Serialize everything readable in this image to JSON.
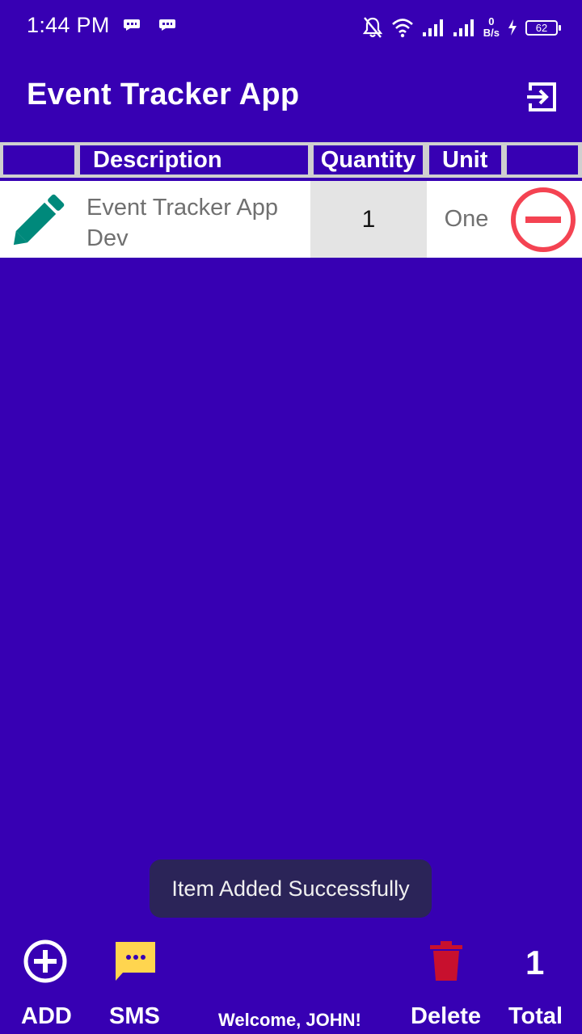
{
  "status_bar": {
    "time": "1:44 PM",
    "net_speed_value": "0",
    "net_speed_unit": "B/s",
    "battery_level": "62"
  },
  "app_bar": {
    "title": "Event Tracker App",
    "logout_icon": "logout-icon"
  },
  "table": {
    "headers": [
      "",
      "Description",
      "Quantity",
      "Unit",
      ""
    ],
    "rows": [
      {
        "description": "Event Tracker App Dev",
        "quantity": "1",
        "unit": "One"
      }
    ]
  },
  "toast": {
    "message": "Item Added Successfully"
  },
  "bottom_bar": {
    "add_label": "ADD",
    "sms_label": "SMS",
    "welcome": "Welcome, JOHN!",
    "delete_label": "Delete",
    "total_label": "Total",
    "total_count": "1"
  },
  "colors": {
    "background": "#3700B3",
    "edit_icon": "#00897B",
    "remove_icon": "#F44352",
    "sms_icon": "#FFD54F",
    "delete_icon": "#C8102E"
  }
}
